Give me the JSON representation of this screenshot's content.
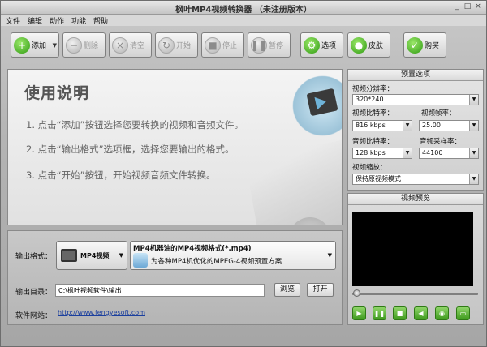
{
  "window": {
    "title": "枫叶MP4视频转换器 （未注册版本）",
    "controls": [
      "_",
      "□",
      "×"
    ]
  },
  "menu": [
    "文件",
    "编辑",
    "动作",
    "功能",
    "帮助"
  ],
  "toolbar": {
    "add": "添加",
    "delete": "删除",
    "clear": "清空",
    "start": "开始",
    "stop": "停止",
    "pause": "暂停",
    "options": "选项",
    "skin": "皮肤",
    "buy": "购买"
  },
  "welcome": {
    "title": "使用说明",
    "steps": [
      "1. 点击“添加”按钮选择您要转换的视频和音频文件。",
      "2. 点击“输出格式”选项框，选择您要输出的格式。",
      "3. 点击“开始”按钮，开始视频音频文件转换。"
    ]
  },
  "output": {
    "format_label": "输出格式：",
    "format_button": "MP4视频",
    "format_name": "MP4机器油的MP4视频格式(*.mp4)",
    "format_desc": "为各种MP4机优化的MPEG-4视频预置方案",
    "dir_label": "输出目录：",
    "dir_value": "C:\\枫叶视频软件\\输出",
    "browse": "浏览",
    "open": "打开",
    "site_label": "软件网站：",
    "site_url": "http://www.fengyesoft.com"
  },
  "settings": {
    "title": "预置选项",
    "resolution_label": "视频分辨率：",
    "resolution": "320*240",
    "vbitrate_label": "视频比特率：",
    "vbitrate": "816 kbps",
    "framerate_label": "视频帧率：",
    "framerate": "25.00",
    "abitrate_label": "音频比特率：",
    "abitrate": "128 kbps",
    "samplerate_label": "音频采样率：",
    "samplerate": "44100",
    "scale_label": "视频缩放：",
    "scale": "保持原视频模式"
  },
  "preview": {
    "title": "视频预览",
    "seek_position": 0
  }
}
